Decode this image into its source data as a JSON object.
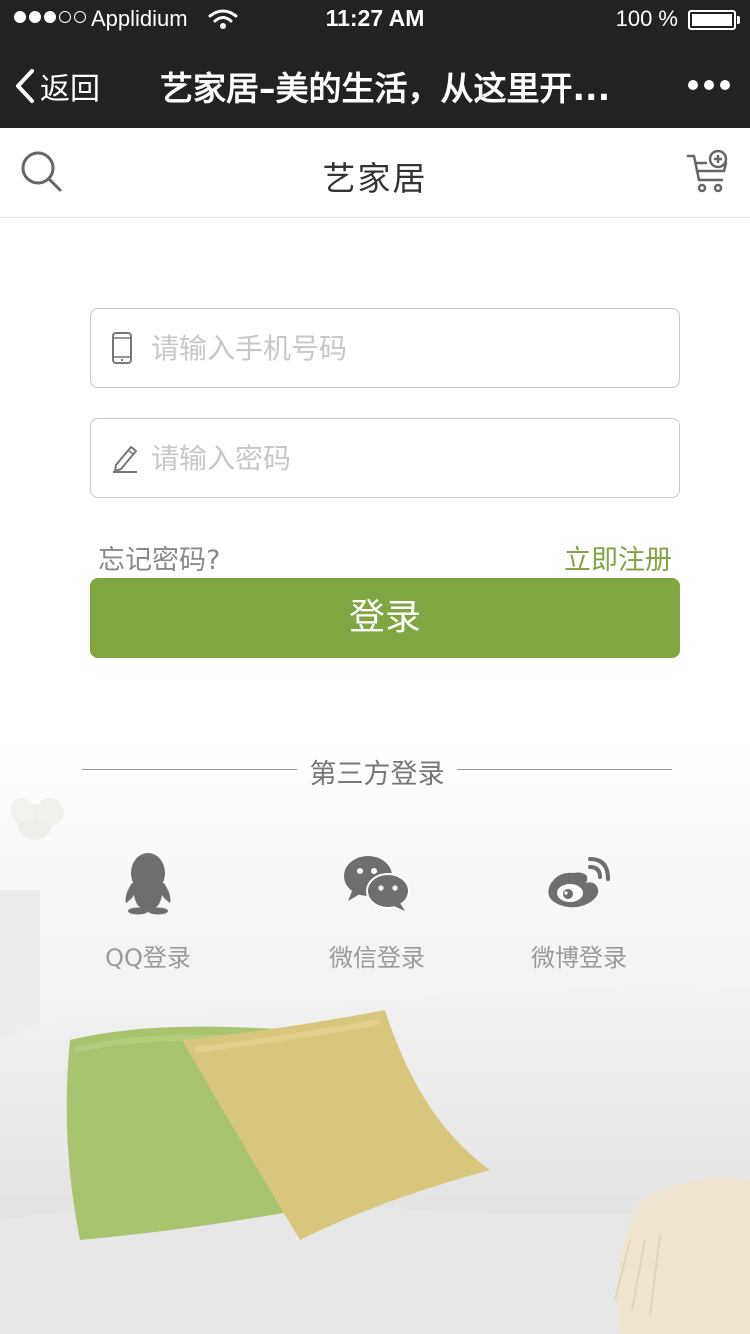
{
  "status_bar": {
    "carrier": "Applidium",
    "time": "11:27 AM",
    "battery": "100 %"
  },
  "nav_bar": {
    "back_label": "返回",
    "title": "艺家居–美的生活，从这里开..."
  },
  "header": {
    "brand": "艺家居"
  },
  "form": {
    "phone_placeholder": "请输入手机号码",
    "password_placeholder": "请输入密码",
    "forgot_label": "忘记密码?",
    "register_label": "立即注册",
    "login_label": "登录"
  },
  "third_party": {
    "title": "第三方登录",
    "items": [
      {
        "label": "QQ登录",
        "icon": "qq-icon"
      },
      {
        "label": "微信登录",
        "icon": "wechat-icon"
      },
      {
        "label": "微博登录",
        "icon": "weibo-icon"
      }
    ]
  },
  "colors": {
    "accent": "#7fa641",
    "bar": "#222222"
  }
}
